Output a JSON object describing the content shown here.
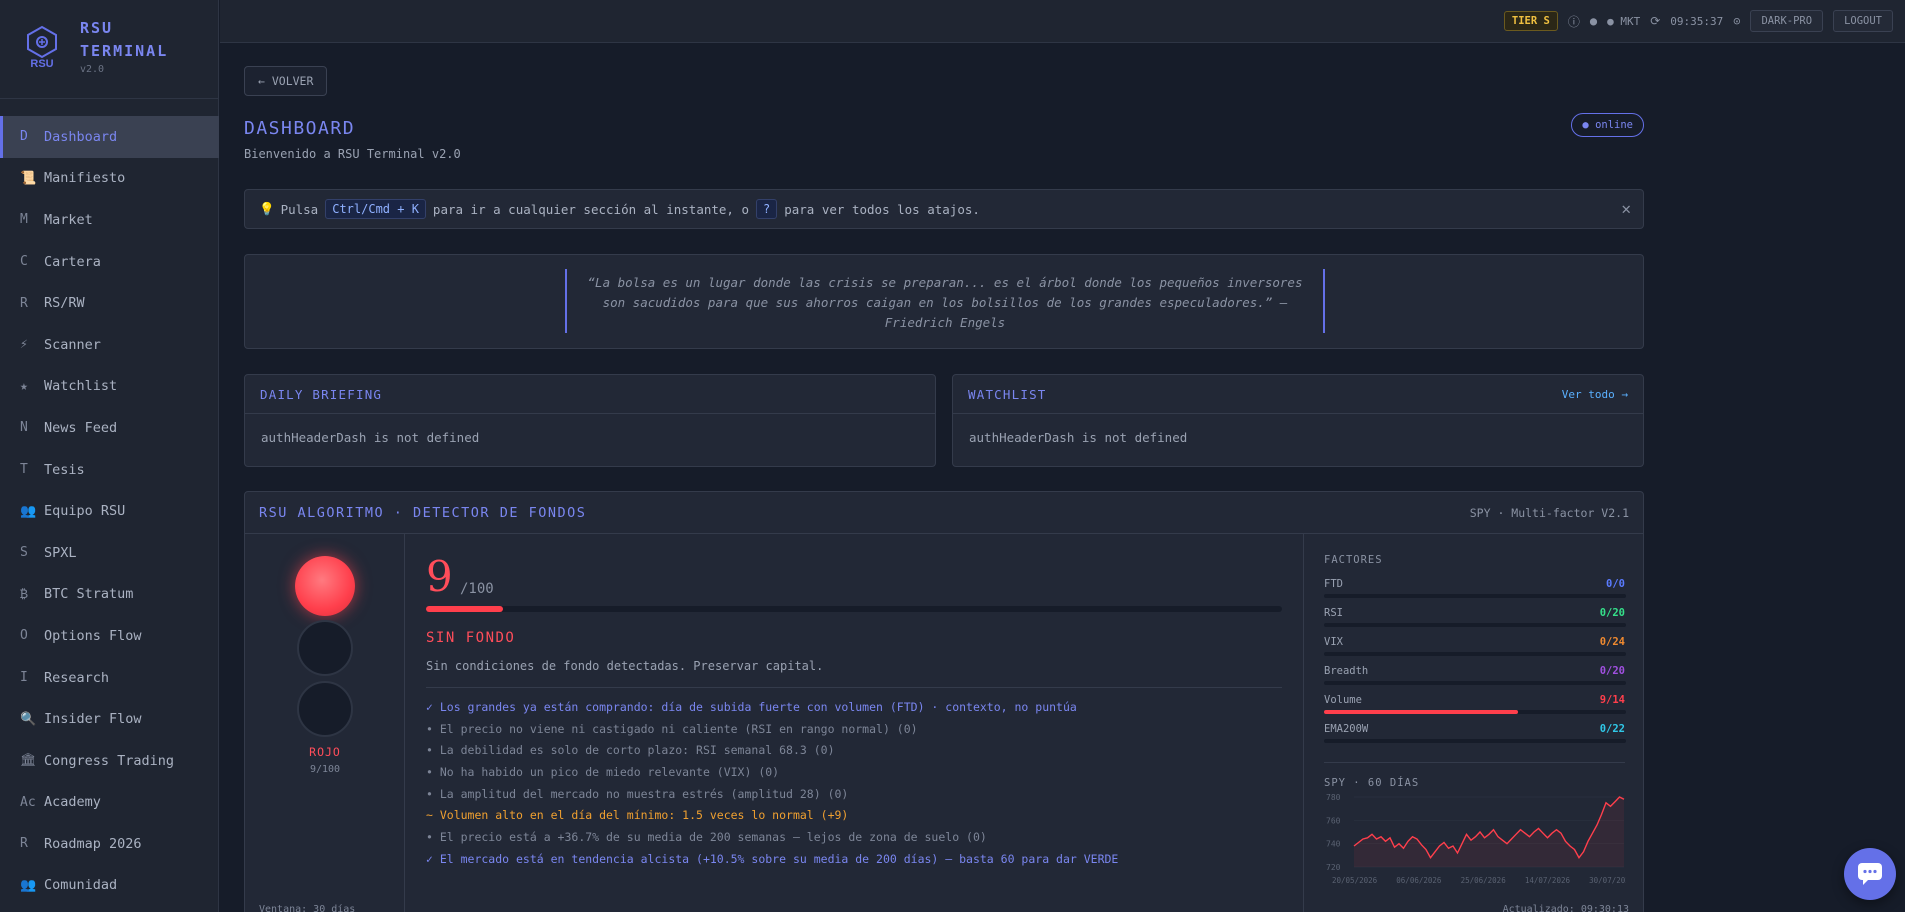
{
  "brand": {
    "name_line1": "RSU",
    "name_line2": "TERMINAL",
    "version": "v2.0",
    "logo_text": "RSU"
  },
  "sidebar": {
    "items": [
      {
        "icon": "D",
        "label": "Dashboard",
        "active": true
      },
      {
        "icon": "📜",
        "label": "Manifiesto"
      },
      {
        "icon": "M",
        "label": "Market"
      },
      {
        "icon": "C",
        "label": "Cartera"
      },
      {
        "icon": "R",
        "label": "RS/RW"
      },
      {
        "icon": "⚡",
        "label": "Scanner"
      },
      {
        "icon": "★",
        "label": "Watchlist"
      },
      {
        "icon": "N",
        "label": "News Feed"
      },
      {
        "icon": "T",
        "label": "Tesis"
      },
      {
        "icon": "👥",
        "label": "Equipo RSU"
      },
      {
        "icon": "S",
        "label": "SPXL"
      },
      {
        "icon": "₿",
        "label": "BTC Stratum"
      },
      {
        "icon": "O",
        "label": "Options Flow"
      },
      {
        "icon": "I",
        "label": "Research"
      },
      {
        "icon": "🔍",
        "label": "Insider Flow"
      },
      {
        "icon": "🏛",
        "label": "Congress Trading"
      },
      {
        "icon": "Ac",
        "label": "Academy"
      },
      {
        "icon": "R",
        "label": "Roadmap 2026"
      },
      {
        "icon": "👥",
        "label": "Comunidad"
      }
    ]
  },
  "topbar": {
    "tier": "TIER S",
    "mkt": "● MKT",
    "time": "09:35:37",
    "theme_btn": "DARK-PRO",
    "logout_btn": "LOGOUT"
  },
  "main": {
    "back_label": "← VOLVER",
    "title": "DASHBOARD",
    "subtitle": "Bienvenido a RSU Terminal v2.0",
    "online_badge": "● online",
    "tip": {
      "prefix": "Pulsa",
      "kbd1": "Ctrl/Cmd + K",
      "mid": "para ir a cualquier sección al instante, o",
      "kbd2": "?",
      "suffix": "para ver todos los atajos."
    },
    "quote": "“La bolsa es un lugar donde las crisis se preparan... es el árbol donde los pequeños inversores son sacudidos para que sus ahorros caigan en los bolsillos de los grandes especuladores.” — Friedrich Engels"
  },
  "briefing": {
    "title": "DAILY BRIEFING",
    "body": "authHeaderDash is not defined"
  },
  "watchlist": {
    "title": "WATCHLIST",
    "link": "Ver todo →",
    "body": "authHeaderDash is not defined"
  },
  "algo": {
    "title": "RSU ALGORITMO · DETECTOR DE FONDOS",
    "meta": "SPY · Multi-factor V2.1",
    "light_label": "ROJO",
    "light_score": "9/100",
    "score": "9",
    "score_of": "/100",
    "score_fraction": 0.09,
    "status": "SIN FONDO",
    "status_desc": "Sin condiciones de fondo detectadas. Preservar capital.",
    "items": [
      {
        "text": "✓ Los grandes ya están comprando: día de subida fuerte con volumen (FTD) · contexto, no puntúa",
        "tone": "blue"
      },
      {
        "text": "• El precio no viene ni castigado ni caliente (RSI en rango normal) (0)",
        "tone": "muted"
      },
      {
        "text": "• La debilidad es solo de corto plazo: RSI semanal 68.3 (0)",
        "tone": "muted"
      },
      {
        "text": "• No ha habido un pico de miedo relevante (VIX) (0)",
        "tone": "muted"
      },
      {
        "text": "• La amplitud del mercado no muestra estrés (amplitud 28) (0)",
        "tone": "muted"
      },
      {
        "text": "~ Volumen alto en el día del mínimo: 1.5 veces lo normal (+9)",
        "tone": "orange"
      },
      {
        "text": "• El precio está a +36.7% de su media de 200 semanas — lejos de zona de suelo (0)",
        "tone": "muted"
      },
      {
        "text": "✓ El mercado está en tendencia alcista (+10.5% sobre su media de 200 días) — basta 60 para dar VERDE",
        "tone": "blue"
      }
    ],
    "factors_title": "FACTORES",
    "factors": [
      {
        "name": "FTD",
        "value": "0/0",
        "fraction": 0,
        "color": "#5a7bff"
      },
      {
        "name": "RSI",
        "value": "0/20",
        "fraction": 0,
        "color": "#35e08a"
      },
      {
        "name": "VIX",
        "value": "0/24",
        "fraction": 0,
        "color": "#f08a30"
      },
      {
        "name": "Breadth",
        "value": "0/20",
        "fraction": 0,
        "color": "#a050e0"
      },
      {
        "name": "Volume",
        "value": "9/14",
        "fraction": 0.643,
        "color": "#ff3f4c"
      },
      {
        "name": "EMA200W",
        "value": "0/22",
        "fraction": 0,
        "color": "#30c8e8"
      }
    ],
    "mini_title": "SPY · 60 DÍAS",
    "mini_yticks": [
      "780",
      "760",
      "740",
      "720"
    ],
    "mini_xticks": [
      "20/05/2026",
      "06/06/2026",
      "25/06/2026",
      "14/07/2026",
      "30/07/2026"
    ],
    "mini_series": [
      738,
      741,
      744,
      745,
      748,
      744,
      746,
      742,
      745,
      737,
      740,
      736,
      742,
      746,
      744,
      739,
      735,
      728,
      733,
      738,
      741,
      736,
      738,
      732,
      740,
      748,
      743,
      746,
      750,
      745,
      748,
      752,
      746,
      743,
      740,
      744,
      748,
      752,
      749,
      746,
      750,
      753,
      749,
      745,
      749,
      752,
      749,
      742,
      738,
      735,
      728,
      733,
      742,
      749,
      756,
      765,
      775,
      772,
      776,
      780,
      778
    ],
    "footer_left": "Ventana: 30 días",
    "footer_right": "Actualizado: 09:30:13"
  }
}
